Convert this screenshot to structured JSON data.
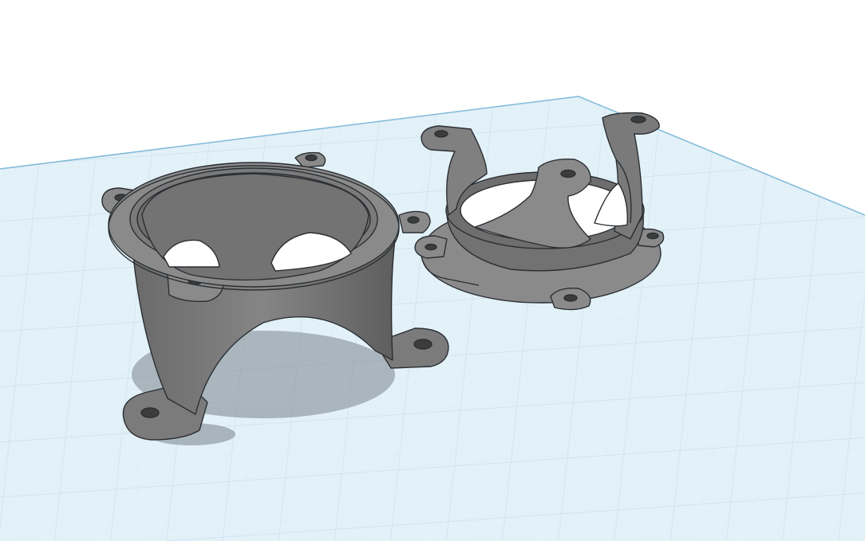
{
  "app": {
    "view": "3d-workplane",
    "background_color": "#ffffff"
  },
  "workplane": {
    "fill_color": "#cfe6f1",
    "grid_minor_color": "#dcecf4",
    "grid_major_color": "#b3d6e6",
    "edge_color": "#7fb9d8"
  },
  "objects": [
    {
      "name": "bracket-cup-with-lip",
      "shape": "round cup with mounting ears and two arched legs",
      "color": "#7a7a7a"
    },
    {
      "name": "bracket-inverted-with-arms",
      "shape": "short round collar with three upward arms and mounting ears",
      "color": "#7a7a7a"
    }
  ],
  "colors": {
    "part_top": "#8a8a8a",
    "part_side": "#6f6f6f",
    "part_dark": "#555555",
    "part_outline": "#2b2f33",
    "shadow": "#8f9aa1"
  }
}
